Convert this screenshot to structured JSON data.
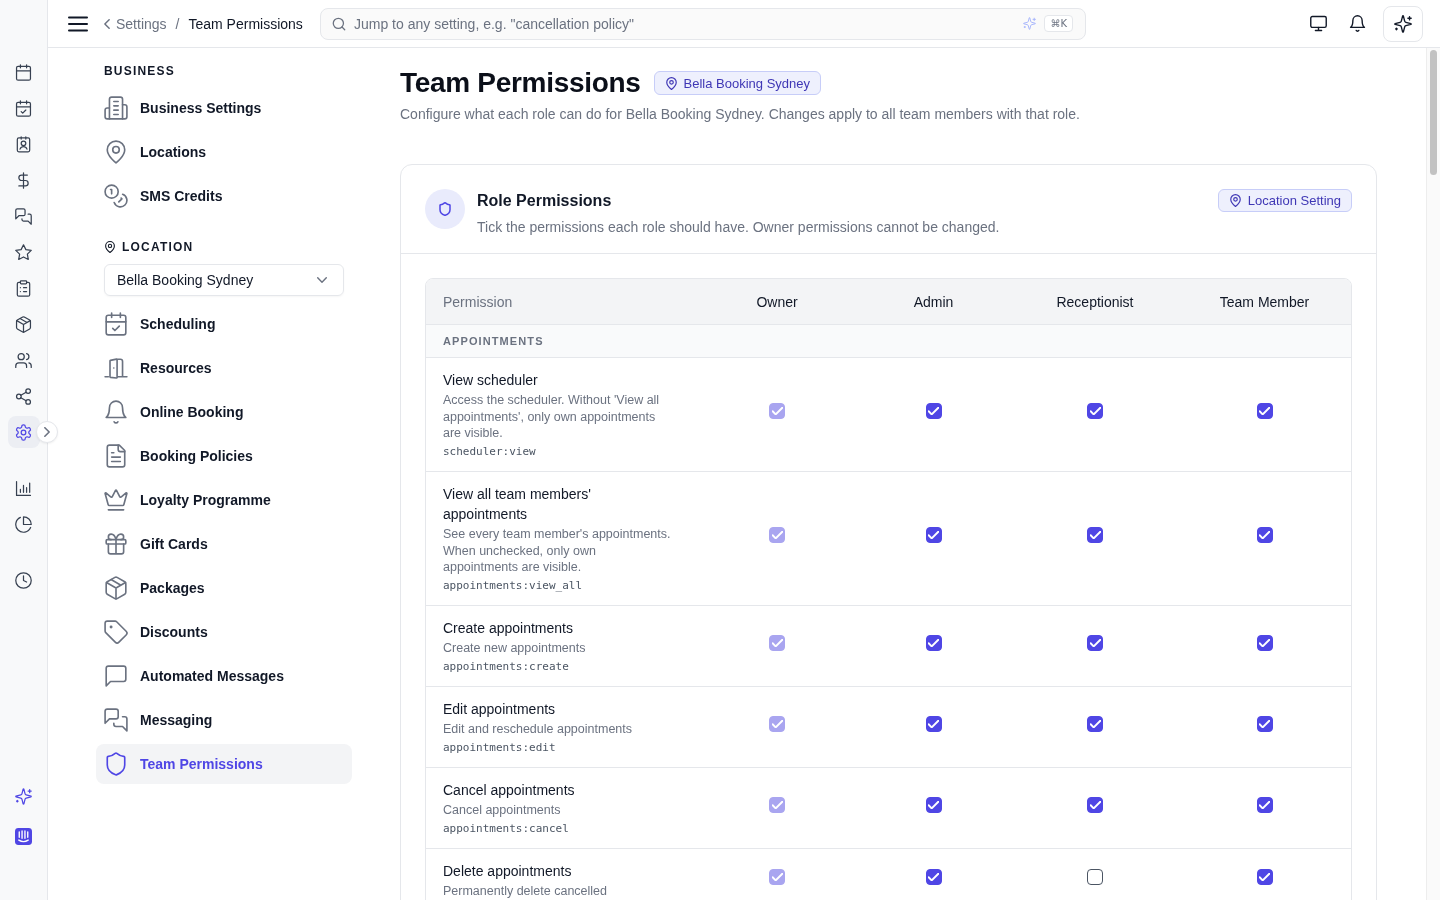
{
  "nav_rail": {
    "groups": [
      {
        "items": [
          {
            "selected": false
          },
          {
            "selected": false
          },
          {
            "selected": false
          },
          {
            "selected": false
          },
          {
            "selected": false
          },
          {
            "selected": false
          },
          {
            "selected": false
          },
          {
            "selected": false
          },
          {
            "selected": false
          },
          {
            "selected": false
          },
          {
            "selected": true
          }
        ]
      },
      {
        "items": [
          {
            "selected": false
          },
          {
            "selected": false
          }
        ]
      },
      {
        "items": [
          {
            "selected": false
          }
        ]
      }
    ]
  },
  "top_bar": {
    "breadcrumb": {
      "parent": "Settings",
      "separator": "/",
      "current": "Team Permissions"
    },
    "search": {
      "placeholder": "Jump to any setting, e.g. \"cancellation policy\"",
      "shortcut": "⌘K"
    }
  },
  "settings_nav": {
    "sections": [
      {
        "kind": "plain",
        "heading": "BUSINESS",
        "items": [
          {
            "label": "Business Settings",
            "selected": false
          },
          {
            "label": "Locations",
            "selected": false
          },
          {
            "label": "SMS Credits",
            "selected": false
          }
        ]
      },
      {
        "kind": "location",
        "heading": "LOCATION",
        "select": {
          "value": "Bella Booking Sydney"
        },
        "items": [
          {
            "label": "Scheduling",
            "selected": false
          },
          {
            "label": "Resources",
            "selected": false
          },
          {
            "label": "Online Booking",
            "selected": false
          },
          {
            "label": "Booking Policies",
            "selected": false
          },
          {
            "label": "Loyalty Programme",
            "selected": false
          },
          {
            "label": "Gift Cards",
            "selected": false
          },
          {
            "label": "Packages",
            "selected": false
          },
          {
            "label": "Discounts",
            "selected": false
          },
          {
            "label": "Automated Messages",
            "selected": false
          },
          {
            "label": "Messaging",
            "selected": false
          },
          {
            "label": "Team Permissions",
            "selected": true
          }
        ]
      }
    ]
  },
  "page": {
    "title": "Team Permissions",
    "location_tag": "Bella Booking Sydney",
    "description": "Configure what each role can do for Bella Booking Sydney. Changes apply to all team members with that role."
  },
  "card": {
    "title": "Role Permissions",
    "description": "Tick the permissions each role should have. Owner permissions cannot be changed.",
    "scope_tag": "Location Setting",
    "table": {
      "columns": [
        "Permission",
        "Owner",
        "Admin",
        "Receptionist",
        "Team Member"
      ],
      "sections": [
        {
          "heading": "APPOINTMENTS",
          "rows": [
            {
              "name": "View scheduler",
              "description": "Access the scheduler. Without 'View all appointments', only own appointments are visible.",
              "code": "scheduler:view",
              "roles": [
                {
                  "checked": true,
                  "disabled": true
                },
                {
                  "checked": true,
                  "disabled": false
                },
                {
                  "checked": true,
                  "disabled": false
                },
                {
                  "checked": true,
                  "disabled": false
                }
              ]
            },
            {
              "name": "View all team members' appointments",
              "description": "See every team member's appointments. When unchecked, only own appointments are visible.",
              "code": "appointments:view_all",
              "roles": [
                {
                  "checked": true,
                  "disabled": true
                },
                {
                  "checked": true,
                  "disabled": false
                },
                {
                  "checked": true,
                  "disabled": false
                },
                {
                  "checked": true,
                  "disabled": false
                }
              ]
            },
            {
              "name": "Create appointments",
              "description": "Create new appointments",
              "code": "appointments:create",
              "roles": [
                {
                  "checked": true,
                  "disabled": true
                },
                {
                  "checked": true,
                  "disabled": false
                },
                {
                  "checked": true,
                  "disabled": false
                },
                {
                  "checked": true,
                  "disabled": false
                }
              ]
            },
            {
              "name": "Edit appointments",
              "description": "Edit and reschedule appointments",
              "code": "appointments:edit",
              "roles": [
                {
                  "checked": true,
                  "disabled": true
                },
                {
                  "checked": true,
                  "disabled": false
                },
                {
                  "checked": true,
                  "disabled": false
                },
                {
                  "checked": true,
                  "disabled": false
                }
              ]
            },
            {
              "name": "Cancel appointments",
              "description": "Cancel appointments",
              "code": "appointments:cancel",
              "roles": [
                {
                  "checked": true,
                  "disabled": true
                },
                {
                  "checked": true,
                  "disabled": false
                },
                {
                  "checked": true,
                  "disabled": false
                },
                {
                  "checked": true,
                  "disabled": false
                }
              ]
            },
            {
              "name": "Delete appointments",
              "description": "Permanently delete cancelled",
              "roles": [
                {
                  "checked": true,
                  "disabled": true
                },
                {
                  "checked": true,
                  "disabled": false
                },
                {
                  "checked": false,
                  "disabled": false
                },
                {
                  "checked": true,
                  "disabled": false
                }
              ]
            }
          ]
        }
      ]
    }
  }
}
